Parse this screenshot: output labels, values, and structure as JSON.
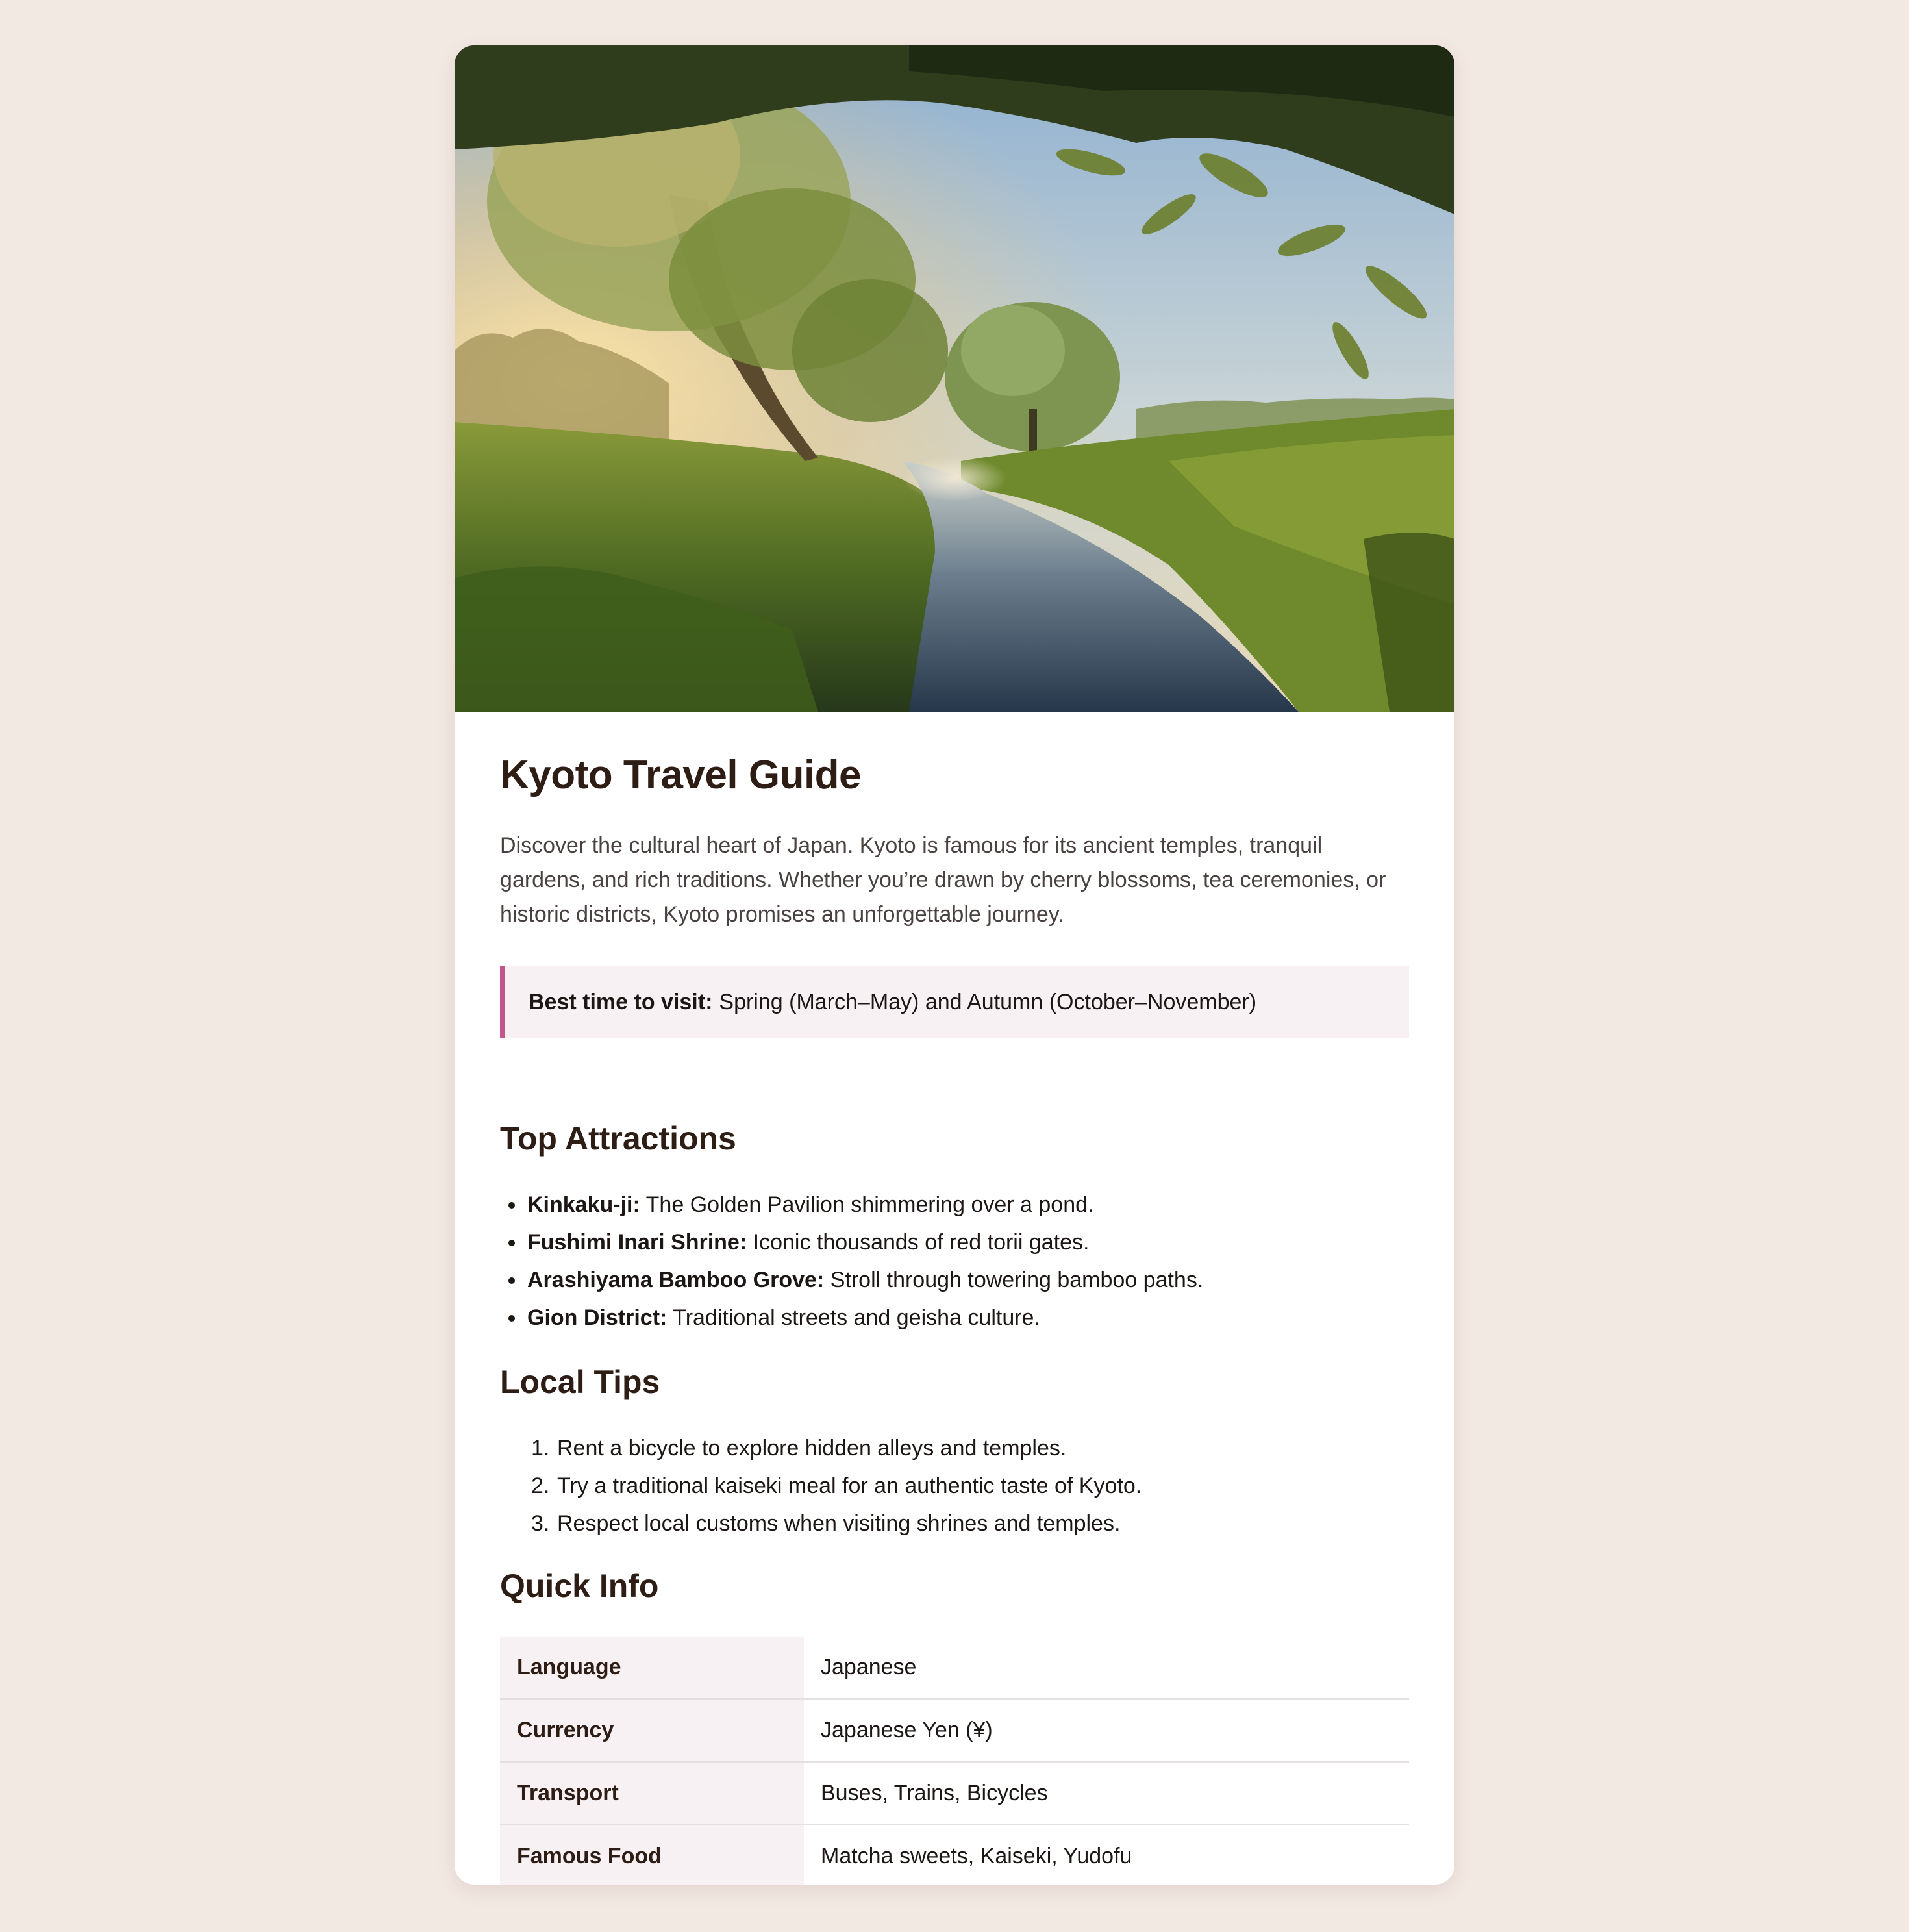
{
  "page": {
    "background_color": "#f3e9e3",
    "accent_color": "#c2548e",
    "heading_color": "#2e1d14"
  },
  "hero": {
    "icon": "landscape-river-photo"
  },
  "title": "Kyoto Travel Guide",
  "intro": "Discover the cultural heart of Japan. Kyoto is famous for its ancient temples, tranquil gardens, and rich traditions. Whether you’re drawn by cherry blossoms, tea ceremonies, or historic districts, Kyoto promises an unforgettable journey.",
  "callout": {
    "label": "Best time to visit:",
    "text": "Spring (March–May) and Autumn (October–November)"
  },
  "attractions": {
    "heading": "Top Attractions",
    "items": [
      {
        "name": "Kinkaku-ji:",
        "desc": "The Golden Pavilion shimmering over a pond."
      },
      {
        "name": "Fushimi Inari Shrine:",
        "desc": "Iconic thousands of red torii gates."
      },
      {
        "name": "Arashiyama Bamboo Grove:",
        "desc": "Stroll through towering bamboo paths."
      },
      {
        "name": "Gion District:",
        "desc": "Traditional streets and geisha culture."
      }
    ]
  },
  "tips": {
    "heading": "Local Tips",
    "items": [
      {
        "num": "1.",
        "text": "Rent a bicycle to explore hidden alleys and temples."
      },
      {
        "num": "2.",
        "text": "Try a traditional kaiseki meal for an authentic taste of Kyoto."
      },
      {
        "num": "3.",
        "text": "Respect local customs when visiting shrines and temples."
      }
    ]
  },
  "quick_info": {
    "heading": "Quick Info",
    "rows": [
      {
        "key": "Language",
        "value": "Japanese"
      },
      {
        "key": "Currency",
        "value": "Japanese Yen (¥)"
      },
      {
        "key": "Transport",
        "value": "Buses, Trains, Bicycles"
      },
      {
        "key": "Famous Food",
        "value": "Matcha sweets, Kaiseki, Yudofu"
      }
    ]
  }
}
